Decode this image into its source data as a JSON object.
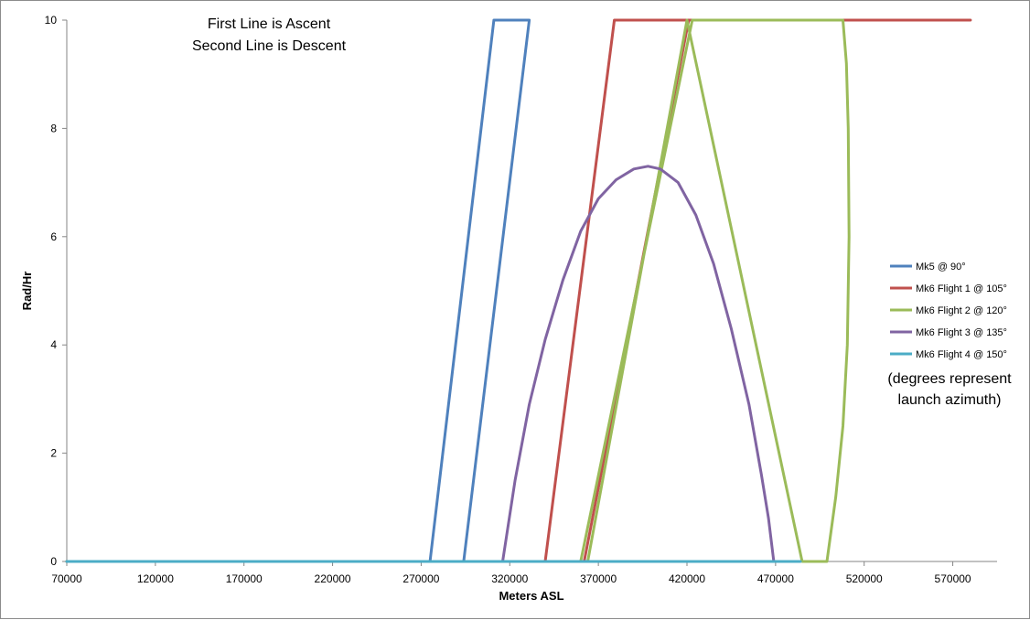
{
  "chart_data": {
    "type": "line",
    "title": "",
    "xlabel": "Meters ASL",
    "ylabel": "Rad/Hr",
    "xlim": [
      70000,
      595000
    ],
    "ylim": [
      0,
      10
    ],
    "x_ticks": [
      "70000",
      "120000",
      "170000",
      "220000",
      "270000",
      "320000",
      "370000",
      "420000",
      "470000",
      "520000",
      "570000"
    ],
    "y_ticks": [
      "0",
      "2",
      "4",
      "6",
      "8",
      "10"
    ],
    "grid": false,
    "legend_position": "right",
    "annotations": {
      "top_line1": "First Line is Ascent",
      "top_line2": "Second Line is Descent",
      "note_line1": "(degrees represent",
      "note_line2": "launch azimuth)"
    },
    "series": [
      {
        "name": "Mk5 @ 90°",
        "color": "#4f81bd",
        "points": [
          [
            70000,
            0
          ],
          [
            275000,
            0
          ],
          [
            311000,
            10
          ],
          [
            313000,
            10
          ],
          [
            331000,
            10
          ],
          [
            294000,
            0
          ],
          [
            70000,
            0
          ]
        ]
      },
      {
        "name": "Mk6 Flight 1 @ 105°",
        "color": "#c0504d",
        "points": [
          [
            70000,
            0
          ],
          [
            340000,
            0
          ],
          [
            379000,
            10
          ],
          [
            381000,
            10
          ],
          [
            580000,
            10
          ],
          [
            421000,
            10
          ],
          [
            362000,
            0
          ],
          [
            70000,
            0
          ]
        ]
      },
      {
        "name": "Mk6 Flight 2 @ 120°",
        "color": "#9bbb59",
        "points": [
          [
            70000,
            0
          ],
          [
            360000,
            0
          ],
          [
            423000,
            10
          ],
          [
            508000,
            10
          ],
          [
            510000,
            9.2
          ],
          [
            511000,
            8
          ],
          [
            511500,
            6
          ],
          [
            510500,
            4
          ],
          [
            508000,
            2.5
          ],
          [
            504000,
            1.2
          ],
          [
            499000,
            0
          ],
          [
            485000,
            0
          ],
          [
            420000,
            10
          ],
          [
            364000,
            0
          ],
          [
            70000,
            0
          ]
        ]
      },
      {
        "name": "Mk6 Flight 3 @ 135°",
        "color": "#8064a2",
        "points": [
          [
            316000,
            0
          ],
          [
            323000,
            1.5
          ],
          [
            331000,
            2.9
          ],
          [
            340000,
            4.1
          ],
          [
            350000,
            5.2
          ],
          [
            360000,
            6.1
          ],
          [
            370000,
            6.7
          ],
          [
            380000,
            7.05
          ],
          [
            390000,
            7.25
          ],
          [
            398000,
            7.3
          ],
          [
            405000,
            7.25
          ],
          [
            415000,
            7.0
          ],
          [
            425000,
            6.4
          ],
          [
            435000,
            5.5
          ],
          [
            445000,
            4.3
          ],
          [
            455000,
            2.9
          ],
          [
            462000,
            1.6
          ],
          [
            466000,
            0.8
          ],
          [
            469000,
            0
          ]
        ]
      },
      {
        "name": "Mk6 Flight 4 @ 150°",
        "color": "#4bacc6",
        "points": [
          [
            70000,
            0
          ],
          [
            484000,
            0
          ]
        ]
      }
    ]
  }
}
